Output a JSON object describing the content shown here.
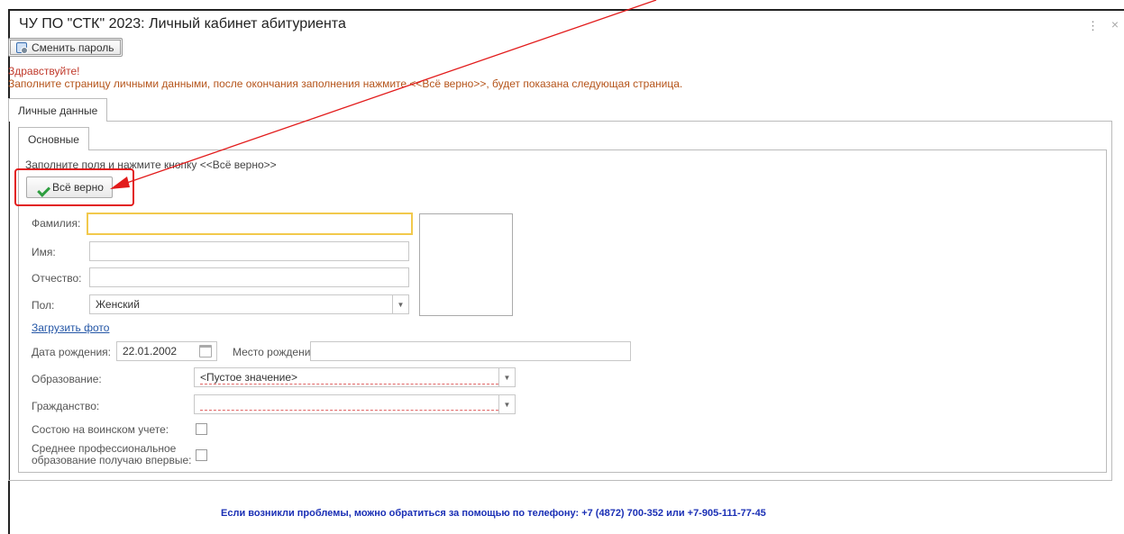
{
  "window": {
    "title": "ЧУ ПО \"СТК\" 2023: Личный кабинет абитуриента",
    "menu_glyph": "⋮",
    "close_glyph": "×"
  },
  "toolbar": {
    "change_password_label": "Сменить пароль"
  },
  "messages": {
    "greeting": "Здравствуйте!",
    "instruction": "Заполните страницу личными данными, после окончания заполнения нажмите <<Всё верно>>, будет показана следующая страница."
  },
  "tabs": {
    "outer": "Личные данные",
    "inner": "Основные"
  },
  "form": {
    "hint": "Заполните поля и нажмите кнопку <<Всё верно>>",
    "ok_label": "Всё верно",
    "surname_label": "Фамилия:",
    "surname_value": "",
    "name_label": "Имя:",
    "name_value": "",
    "patronymic_label": "Отчество:",
    "patronymic_value": "",
    "gender_label": "Пол:",
    "gender_value": "Женский",
    "upload_photo": "Загрузить фото",
    "birth_date_label": "Дата рождения:",
    "birth_date_value": "22.01.2002",
    "birth_place_label": "Место рождения:",
    "birth_place_value": "",
    "education_label": "Образование:",
    "education_value": "<Пустое значение>",
    "citizenship_label": "Гражданство:",
    "citizenship_value": "",
    "military_label": "Состою на воинском учете:",
    "military_checked": false,
    "spo_label_line1": "Среднее профессиональное",
    "spo_label_line2": "образование получаю впервые:",
    "spo_checked": false
  },
  "footer": {
    "help_text": "Если возникли проблемы, можно обратиться за помощью по телефону:  +7 (4872) 700-352 или +7-905-111-77-45"
  },
  "colors": {
    "annotation_red": "#e21b1b",
    "link_blue": "#2456a6",
    "footer_blue": "#1a2fb5",
    "focus_yellow": "#f2c94c",
    "check_green": "#2e9e3f"
  }
}
